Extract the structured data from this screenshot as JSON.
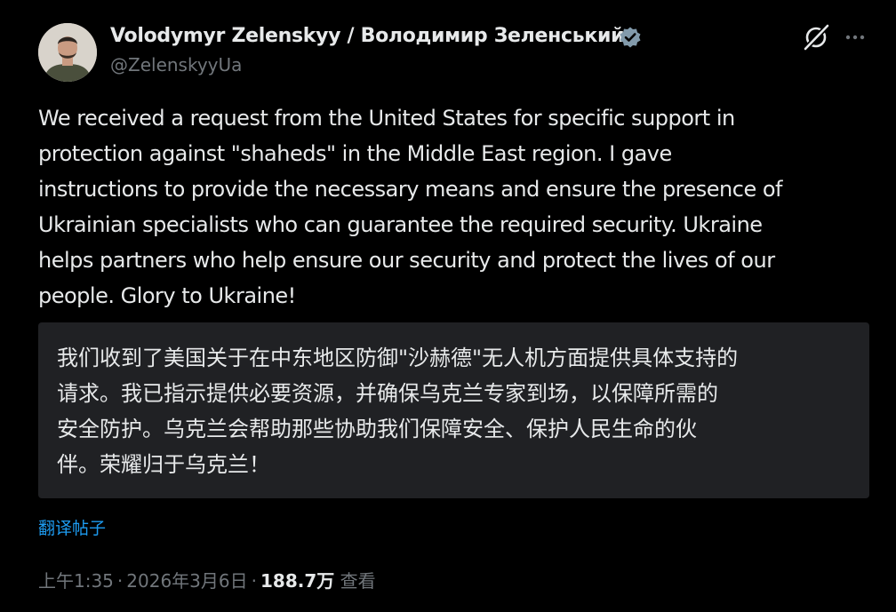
{
  "author": {
    "name": "Volodymyr Zelenskyy / Володимир Зеленський",
    "handle": "@ZelenskyyUa",
    "verified": true
  },
  "icons": {
    "verified": "verified-badge-icon",
    "grok": "grok-icon",
    "more": "more-options-icon"
  },
  "post": {
    "text": "We received a request from the United States for specific support in\nprotection against \"shaheds\" in the Middle East region. I gave\ninstructions to provide the necessary means and ensure the presence of\nUkrainian specialists who can guarantee the required security. Ukraine\nhelps partners who help ensure our security and protect the lives of our\npeople. Glory to Ukraine!"
  },
  "translation": {
    "text": "我们收到了美国关于在中东地区防御\"沙赫德\"无人机方面提供具体支持的\n请求。我已指示提供必要资源，并确保乌克兰专家到场，以保障所需的\n安全防护。乌克兰会帮助那些协助我们保障安全、保护人民生命的伙\n伴。荣耀归于乌克兰！",
    "link_label": "翻译帖子"
  },
  "meta": {
    "time": "上午1:35",
    "separator": "·",
    "date": "2026年3月6日",
    "views_count": "188.7万",
    "views_label": "查看"
  },
  "colors": {
    "background": "#000000",
    "text_primary": "#e7e9ea",
    "text_secondary": "#71767b",
    "link": "#1d9bf0",
    "translation_bg": "#202124"
  }
}
